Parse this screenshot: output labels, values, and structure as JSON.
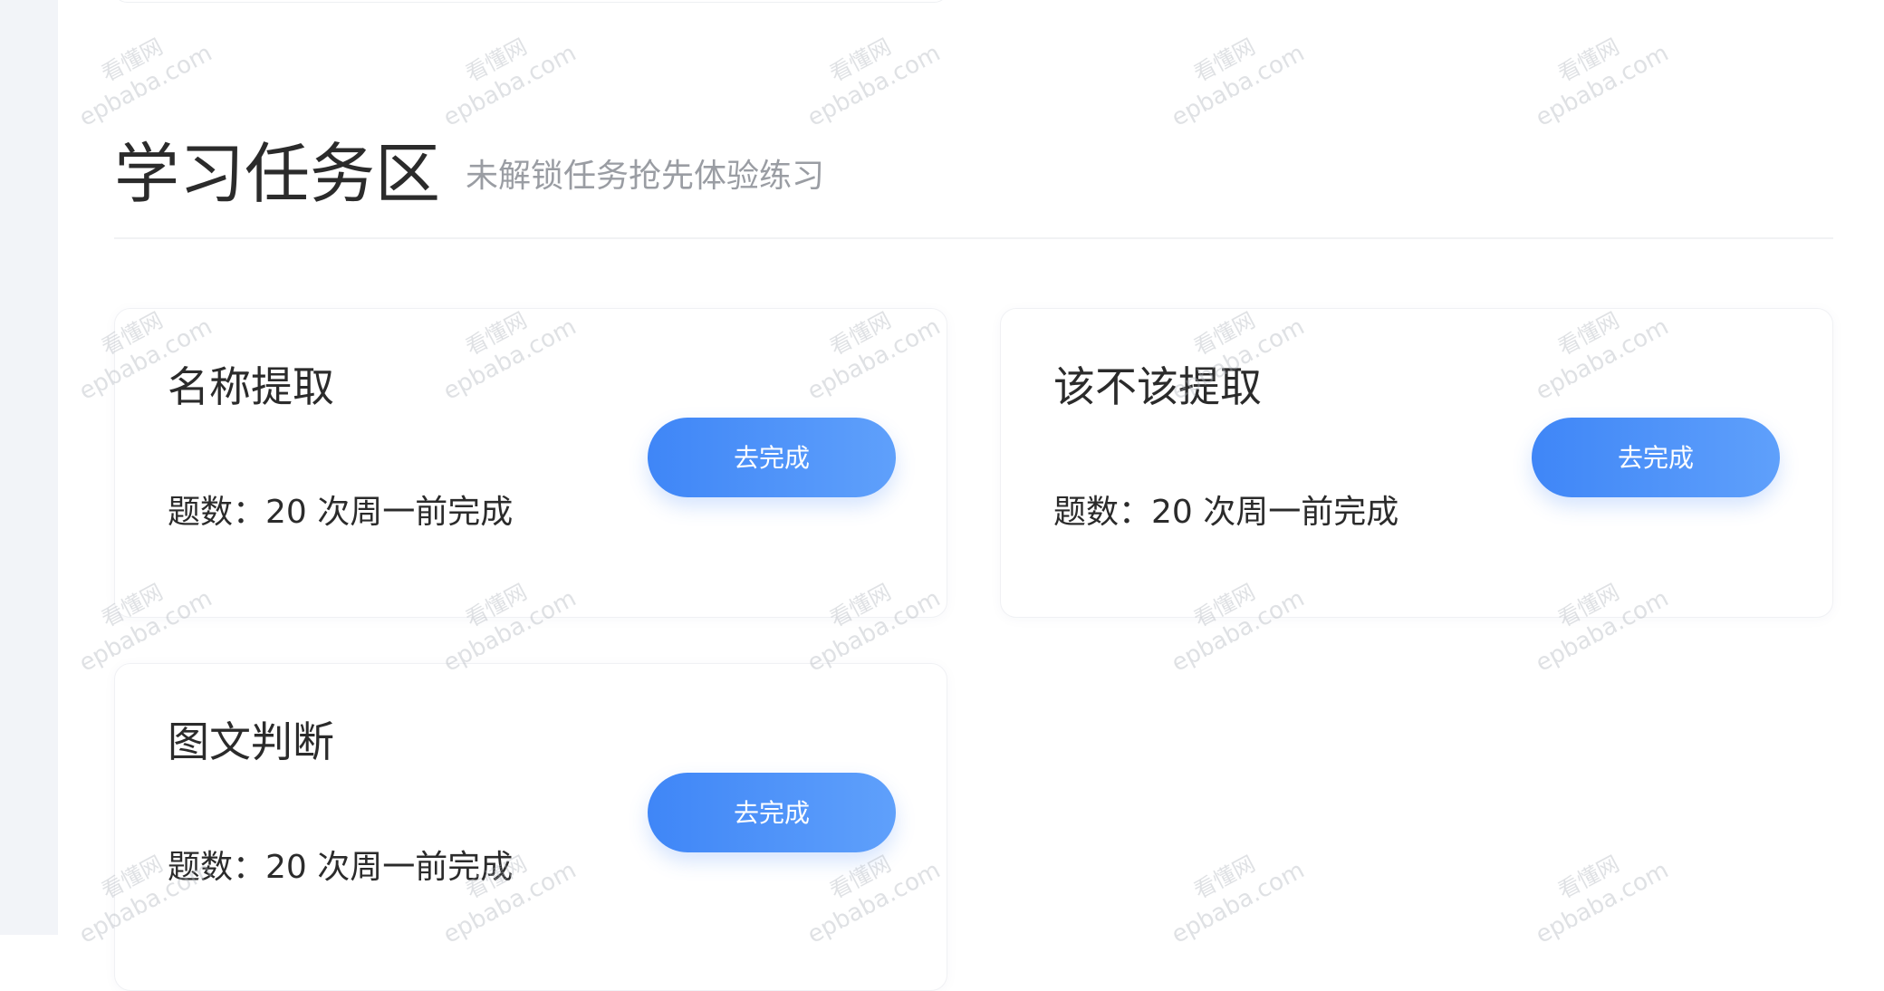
{
  "section": {
    "title": "学习任务区",
    "subtitle": "未解锁任务抢先体验练习"
  },
  "tasks": [
    {
      "title": "名称提取",
      "meta": "题数：20 次周一前完成",
      "button": "去完成"
    },
    {
      "title": "该不该提取",
      "meta": "题数：20 次周一前完成",
      "button": "去完成"
    },
    {
      "title": "图文判断",
      "meta": "题数：20 次周一前完成",
      "button": "去完成"
    }
  ],
  "watermark": {
    "line1": "看懂网",
    "line2": "epbaba.com"
  }
}
